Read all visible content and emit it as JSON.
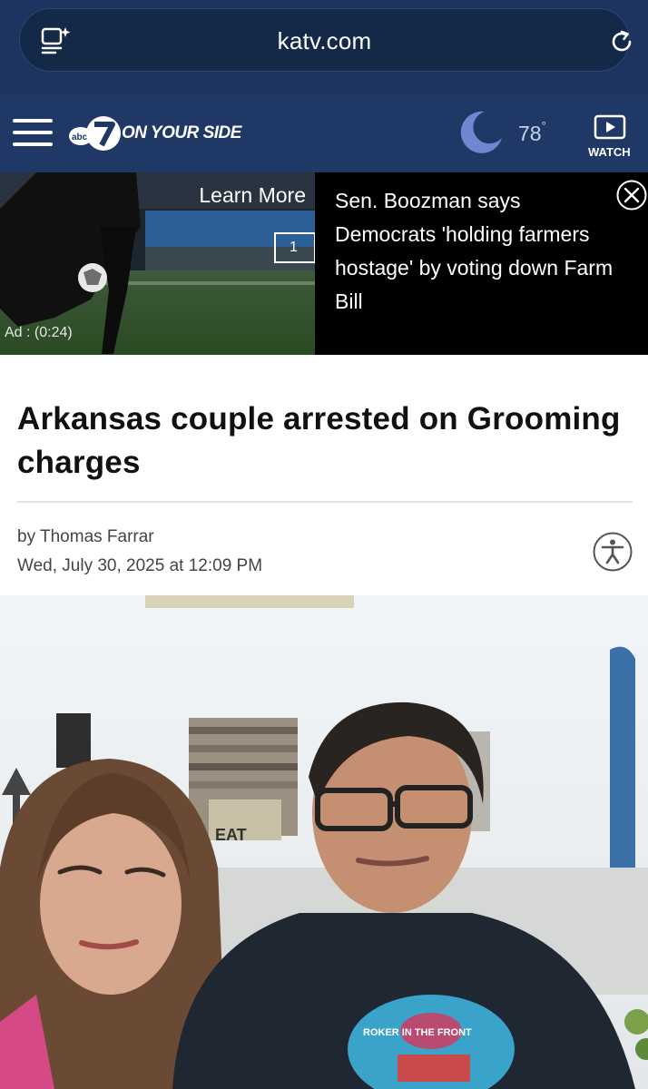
{
  "browser": {
    "url": "katv.com",
    "left_icon": "page-settings-icon",
    "right_icon": "reload-icon"
  },
  "header": {
    "menu_icon": "hamburger-menu-icon",
    "logo_brand": "abc 7",
    "logo_text": "ON YOUR SIDE",
    "weather_icon": "moon-icon",
    "temperature": "78",
    "temperature_unit": "°",
    "watch_icon": "play-icon",
    "watch_label": "WATCH"
  },
  "ad": {
    "learn_more": "Learn More",
    "count": "1",
    "timer": "Ad : (0:24)"
  },
  "promo": {
    "text": "Sen. Boozman says Democrats 'holding farmers hostage' by voting down Farm Bill",
    "close_icon": "close-icon"
  },
  "article": {
    "headline": "Arkansas couple arrested on Grooming charges",
    "byline": "by Thomas Farrar",
    "date": "Wed, July 30, 2025 at 12:09 PM",
    "accessibility_icon": "accessibility-icon"
  },
  "photo": {
    "kitchen_sign_text": "EAT",
    "shirt_text": "ROKER IN THE FRONT"
  },
  "colors": {
    "browser_bar": "#1d3461",
    "header_bg": "#1f3865",
    "promo_bg": "#000000",
    "headline": "#111111",
    "moon": "#6f86d0"
  }
}
